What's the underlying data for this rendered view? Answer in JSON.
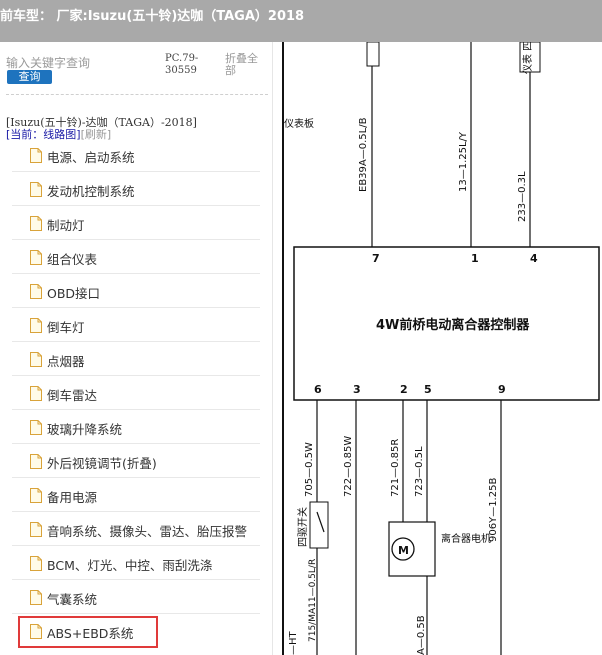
{
  "window": {
    "title": "前车型：  厂家:Isuzu(五十铃)达咖（TAGA）2018"
  },
  "sidebar": {
    "search_placeholder": "输入关键字查询",
    "query_button": "查询",
    "pc_code": "PC.79-30559",
    "collapse_all": "折叠全部",
    "model_line": "[Isuzu(五十铃)-达咖（TAGA）-2018]",
    "current_label": "[当前：线路图]",
    "refresh_label": "[刷新]",
    "items": [
      {
        "label": "电源、启动系统"
      },
      {
        "label": "发动机控制系统"
      },
      {
        "label": "制动灯"
      },
      {
        "label": "组合仪表"
      },
      {
        "label": "OBD接口"
      },
      {
        "label": "倒车灯"
      },
      {
        "label": "点烟器"
      },
      {
        "label": "倒车雷达"
      },
      {
        "label": "玻璃升降系统"
      },
      {
        "label": "外后视镜调节(折叠)"
      },
      {
        "label": "备用电源"
      },
      {
        "label": "音响系统、摄像头、雷达、胎压报警"
      },
      {
        "label": "BCM、灯光、中控、雨刮洗涤"
      },
      {
        "label": "气囊系统"
      },
      {
        "label": "ABS+EBD系统",
        "highlighted": true
      }
    ],
    "highlight_color": "#e03a3a",
    "accent_color": "#1e73be"
  },
  "diagram": {
    "controller_label": "4W前桥电动离合器控制器",
    "top_left_label": "仪表板",
    "top_right_label": "仪表\n四驱",
    "wires_top": [
      "EB39A—0.5L/B",
      "13—1.25L/Y",
      "233—0.3L"
    ],
    "pins_top": [
      "7",
      "1",
      "4"
    ],
    "pins_bottom": [
      "6",
      "3",
      "2",
      "5",
      "9"
    ],
    "wires_bottom": [
      "705—0.5W",
      "722—0.85W",
      "721—0.85R",
      "723—0.5L",
      "906Y—1.25B"
    ],
    "switch_label": "四驱开关",
    "motor_symbol": "M",
    "motor_label": "离合器电机",
    "wire_lower_1": "715/MA11—0.5L/R",
    "wire_lower_2": "A—0.5B",
    "wire_lower_3": "—HT"
  }
}
